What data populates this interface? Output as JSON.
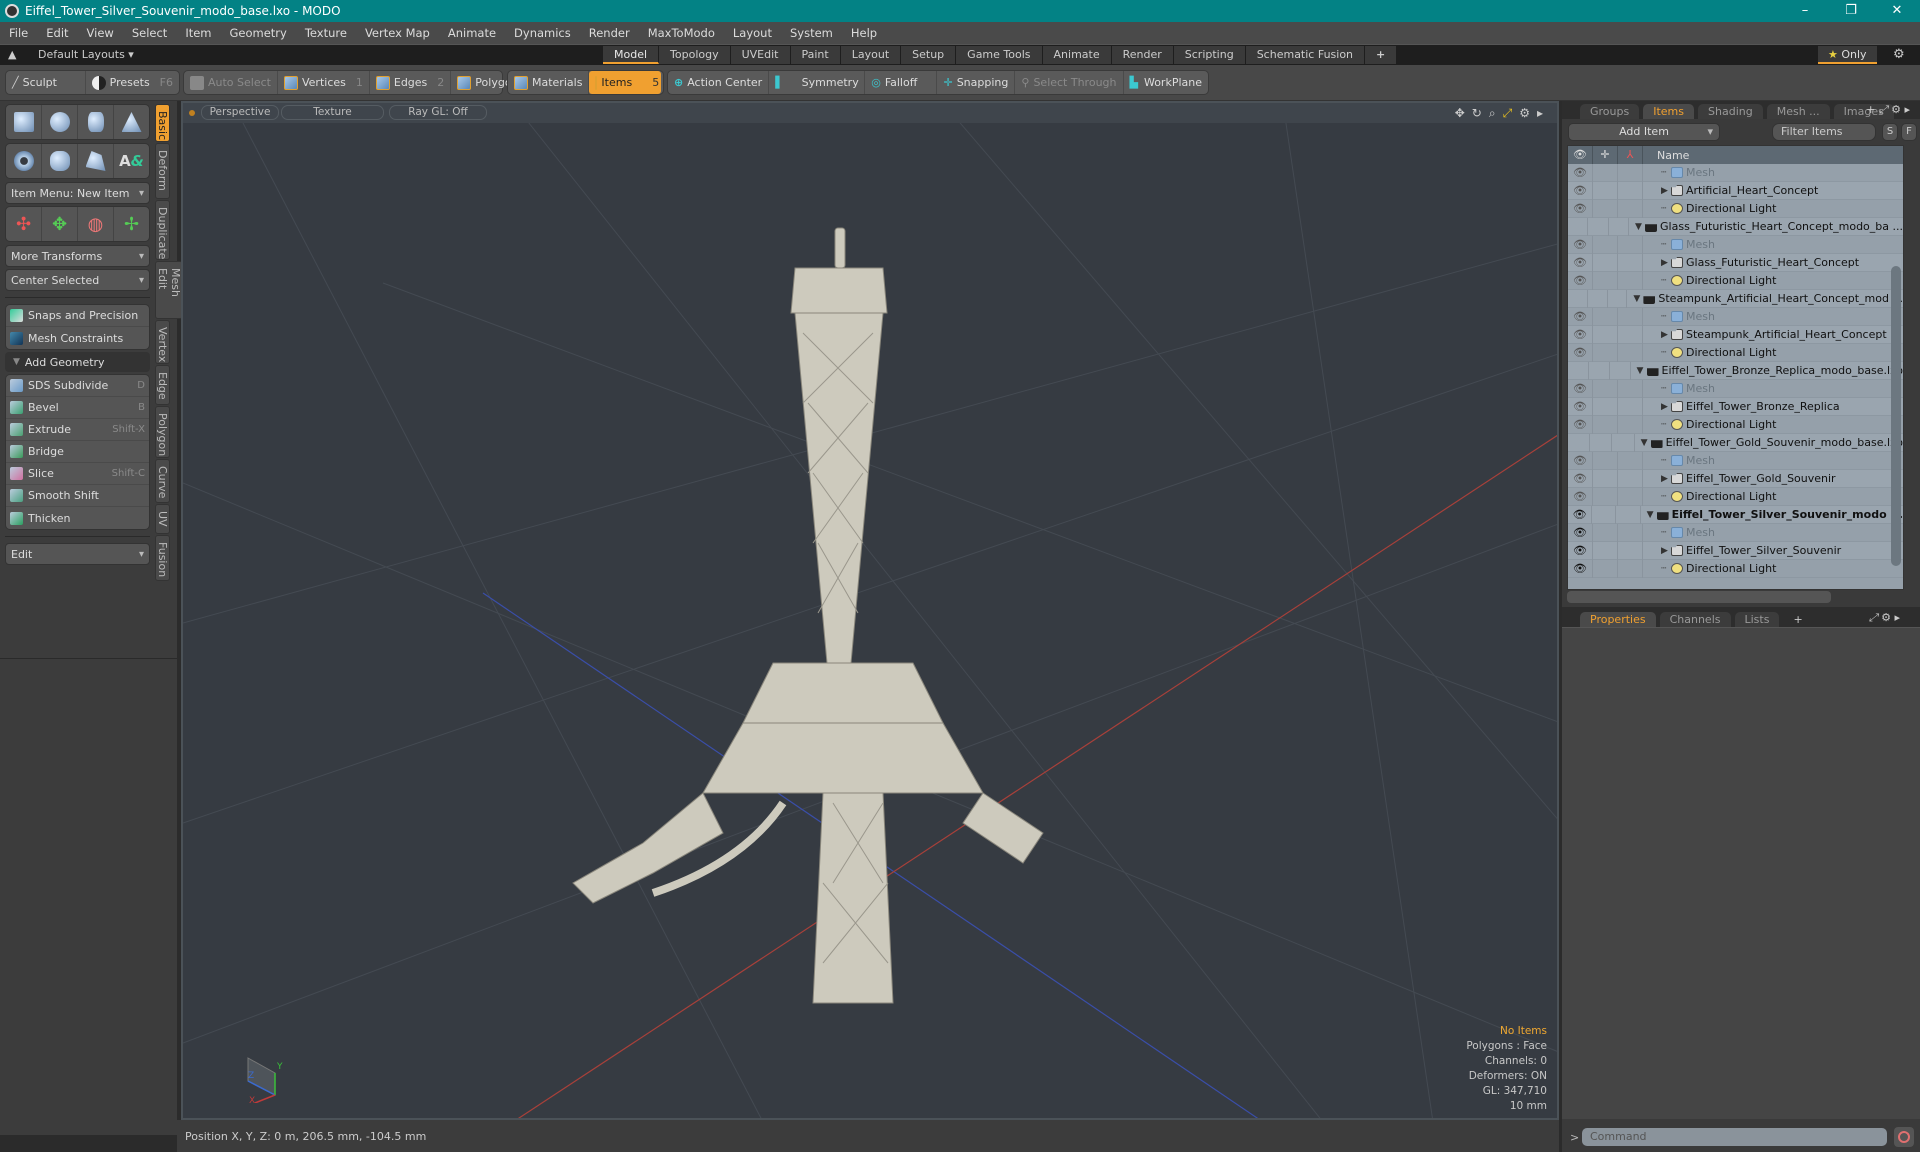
{
  "window": {
    "title": "Eiffel_Tower_Silver_Souvenir_modo_base.lxo - MODO",
    "controls": [
      "–",
      "❐",
      "✕"
    ]
  },
  "menu": [
    "File",
    "Edit",
    "View",
    "Select",
    "Item",
    "Geometry",
    "Texture",
    "Vertex Map",
    "Animate",
    "Dynamics",
    "Render",
    "MaxToModo",
    "Layout",
    "System",
    "Help"
  ],
  "layoutbar": {
    "default_layouts": "Default Layouts ▾",
    "tabs": [
      "Model",
      "Topology",
      "UVEdit",
      "Paint",
      "Layout",
      "Setup",
      "Game Tools",
      "Animate",
      "Render",
      "Scripting",
      "Schematic Fusion"
    ],
    "active_tab": "Model",
    "add": "+",
    "only_label": "Only",
    "only_star": "★"
  },
  "toolbar": {
    "sculpt": "Sculpt",
    "presets": "Presets",
    "presets_key": "F6",
    "auto_select": "Auto Select",
    "vertices": "Vertices",
    "vertices_key": "1",
    "edges": "Edges",
    "edges_key": "2",
    "polygons": "Polygons",
    "materials": "Materials",
    "items": "Items",
    "items_key": "5",
    "action_center": "Action Center",
    "symmetry": "Symmetry",
    "falloff": "Falloff",
    "snapping": "Snapping",
    "select_through": "Select Through",
    "workplane": "WorkPlane"
  },
  "leftpanel": {
    "item_menu": "Item Menu: New Item",
    "more_transforms": "More Transforms",
    "center_selected": "Center Selected",
    "snaps": "Snaps and Precision",
    "mesh_constraints": "Mesh Constraints",
    "add_geometry": "Add Geometry",
    "tools": [
      {
        "label": "SDS Subdivide",
        "key": "D"
      },
      {
        "label": "Bevel",
        "key": "B"
      },
      {
        "label": "Extrude",
        "key": "Shift-X"
      },
      {
        "label": "Bridge",
        "key": ""
      },
      {
        "label": "Slice",
        "key": "Shift-C"
      },
      {
        "label": "Smooth Shift",
        "key": ""
      },
      {
        "label": "Thicken",
        "key": ""
      }
    ],
    "edit": "Edit",
    "vtabs": [
      "Basic",
      "Deform",
      "Duplicate",
      "Mesh Edit",
      "Vertex",
      "Edge",
      "Polygon",
      "Curve",
      "UV",
      "Fusion"
    ]
  },
  "viewport": {
    "view": "Perspective",
    "shading": "Texture",
    "raygl": "Ray GL: Off",
    "info": {
      "selection": "No Items",
      "polygons": "Polygons : Face",
      "channels": "Channels: 0",
      "deformers": "Deformers: ON",
      "gl": "GL: 347,710",
      "scale": "10 mm"
    },
    "axis_labels": {
      "x": "X",
      "y": "Y",
      "z": "Z"
    }
  },
  "statusbar": {
    "position": "Position X, Y, Z:   0 m, 206.5 mm, -104.5 mm"
  },
  "rightpanel": {
    "tabs": [
      "Groups",
      "Items",
      "Shading",
      "Mesh ...",
      "Images"
    ],
    "active_tab": "Items",
    "add_item": "Add Item",
    "filter_placeholder": "Filter Items",
    "s_btn": "S",
    "f_btn": "F",
    "name_col": "Name",
    "tree": [
      {
        "type": "mesh",
        "label": "Mesh",
        "indent": 2,
        "vis": true,
        "bold": false
      },
      {
        "type": "group",
        "label": "Artificial_Heart_Concept",
        "indent": 2,
        "vis": true,
        "bold": false,
        "expand": "▶"
      },
      {
        "type": "light",
        "label": "Directional Light",
        "indent": 2,
        "vis": true,
        "bold": false
      },
      {
        "type": "scene",
        "label": "Glass_Futuristic_Heart_Concept_modo_ba ...",
        "indent": 1,
        "vis": false,
        "bold": false,
        "expand": "▼"
      },
      {
        "type": "mesh",
        "label": "Mesh",
        "indent": 2,
        "vis": true,
        "bold": false
      },
      {
        "type": "group",
        "label": "Glass_Futuristic_Heart_Concept",
        "indent": 2,
        "vis": true,
        "bold": false,
        "expand": "▶"
      },
      {
        "type": "light",
        "label": "Directional Light",
        "indent": 2,
        "vis": true,
        "bold": false
      },
      {
        "type": "scene",
        "label": "Steampunk_Artificial_Heart_Concept_mod ...",
        "indent": 1,
        "vis": false,
        "bold": false,
        "expand": "▼"
      },
      {
        "type": "mesh",
        "label": "Mesh",
        "indent": 2,
        "vis": true,
        "bold": false
      },
      {
        "type": "group",
        "label": "Steampunk_Artificial_Heart_Concept",
        "indent": 2,
        "vis": true,
        "bold": false,
        "expand": "▶"
      },
      {
        "type": "light",
        "label": "Directional Light",
        "indent": 2,
        "vis": true,
        "bold": false
      },
      {
        "type": "scene",
        "label": "Eiffel_Tower_Bronze_Replica_modo_base.lxo",
        "indent": 1,
        "vis": false,
        "bold": false,
        "expand": "▼"
      },
      {
        "type": "mesh",
        "label": "Mesh",
        "indent": 2,
        "vis": true,
        "bold": false
      },
      {
        "type": "group",
        "label": "Eiffel_Tower_Bronze_Replica",
        "indent": 2,
        "vis": true,
        "bold": false,
        "expand": "▶"
      },
      {
        "type": "light",
        "label": "Directional Light",
        "indent": 2,
        "vis": true,
        "bold": false
      },
      {
        "type": "scene",
        "label": "Eiffel_Tower_Gold_Souvenir_modo_base.lxo",
        "indent": 1,
        "vis": false,
        "bold": false,
        "expand": "▼"
      },
      {
        "type": "mesh",
        "label": "Mesh",
        "indent": 2,
        "vis": true,
        "bold": false
      },
      {
        "type": "group",
        "label": "Eiffel_Tower_Gold_Souvenir",
        "indent": 2,
        "vis": true,
        "bold": false,
        "expand": "▶"
      },
      {
        "type": "light",
        "label": "Directional Light",
        "indent": 2,
        "vis": true,
        "bold": false
      },
      {
        "type": "scene",
        "label": "Eiffel_Tower_Silver_Souvenir_modo ...",
        "indent": 1,
        "vis": true,
        "bold": true,
        "expand": "▼",
        "active": true
      },
      {
        "type": "mesh",
        "label": "Mesh",
        "indent": 2,
        "vis": true,
        "bold": false,
        "active": true
      },
      {
        "type": "group",
        "label": "Eiffel_Tower_Silver_Souvenir",
        "indent": 2,
        "vis": true,
        "bold": false,
        "expand": "▶",
        "active": true
      },
      {
        "type": "light",
        "label": "Directional Light",
        "indent": 2,
        "vis": true,
        "bold": false,
        "active": true
      }
    ],
    "prop_tabs": [
      "Properties",
      "Channels",
      "Lists"
    ],
    "active_prop_tab": "Properties",
    "command_placeholder": "Command"
  }
}
